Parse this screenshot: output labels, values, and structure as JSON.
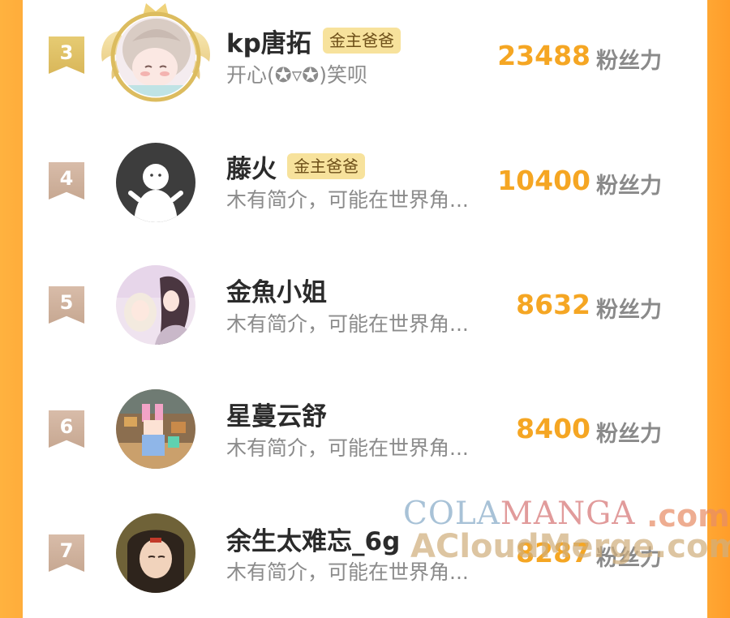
{
  "rows": [
    {
      "rank": "3",
      "name": "kp唐拓",
      "tag": "金主爸爸",
      "bio": "开心(✪▿✪)笑呗",
      "score": "23488",
      "unit": "粉丝力",
      "avatar_icon": "anime-girl-avatar",
      "badge": "crown-wings"
    },
    {
      "rank": "4",
      "name": "藤火",
      "tag": "金主爸爸",
      "bio": "木有简介，可能在世界角...",
      "score": "10400",
      "unit": "粉丝力",
      "avatar_icon": "default-user-avatar"
    },
    {
      "rank": "5",
      "name": "金魚小姐",
      "bio": "木有简介，可能在世界角...",
      "score": "8632",
      "unit": "粉丝力",
      "avatar_icon": "anime-couple-avatar"
    },
    {
      "rank": "6",
      "name": "星蔓云舒",
      "bio": "木有简介，可能在世界角...",
      "score": "8400",
      "unit": "粉丝力",
      "avatar_icon": "pixel-game-avatar"
    },
    {
      "rank": "7",
      "name": "余生太难忘_6g",
      "bio": "木有简介，可能在世界角...",
      "score": "8287",
      "unit": "粉丝力",
      "avatar_icon": "anime-boy-avatar"
    }
  ],
  "watermark": {
    "line1_a": "COLA",
    "line1_b": "MANGA",
    "line1_c": ".com",
    "line2": "ACloudMerge.com"
  },
  "colors": {
    "accent_orange": "#f5a623",
    "side_bar": "#ffa733",
    "tag_bg": "#f7e29c",
    "rank_gold": "#dcbc5f",
    "rank_beige": "#cdb09c"
  }
}
